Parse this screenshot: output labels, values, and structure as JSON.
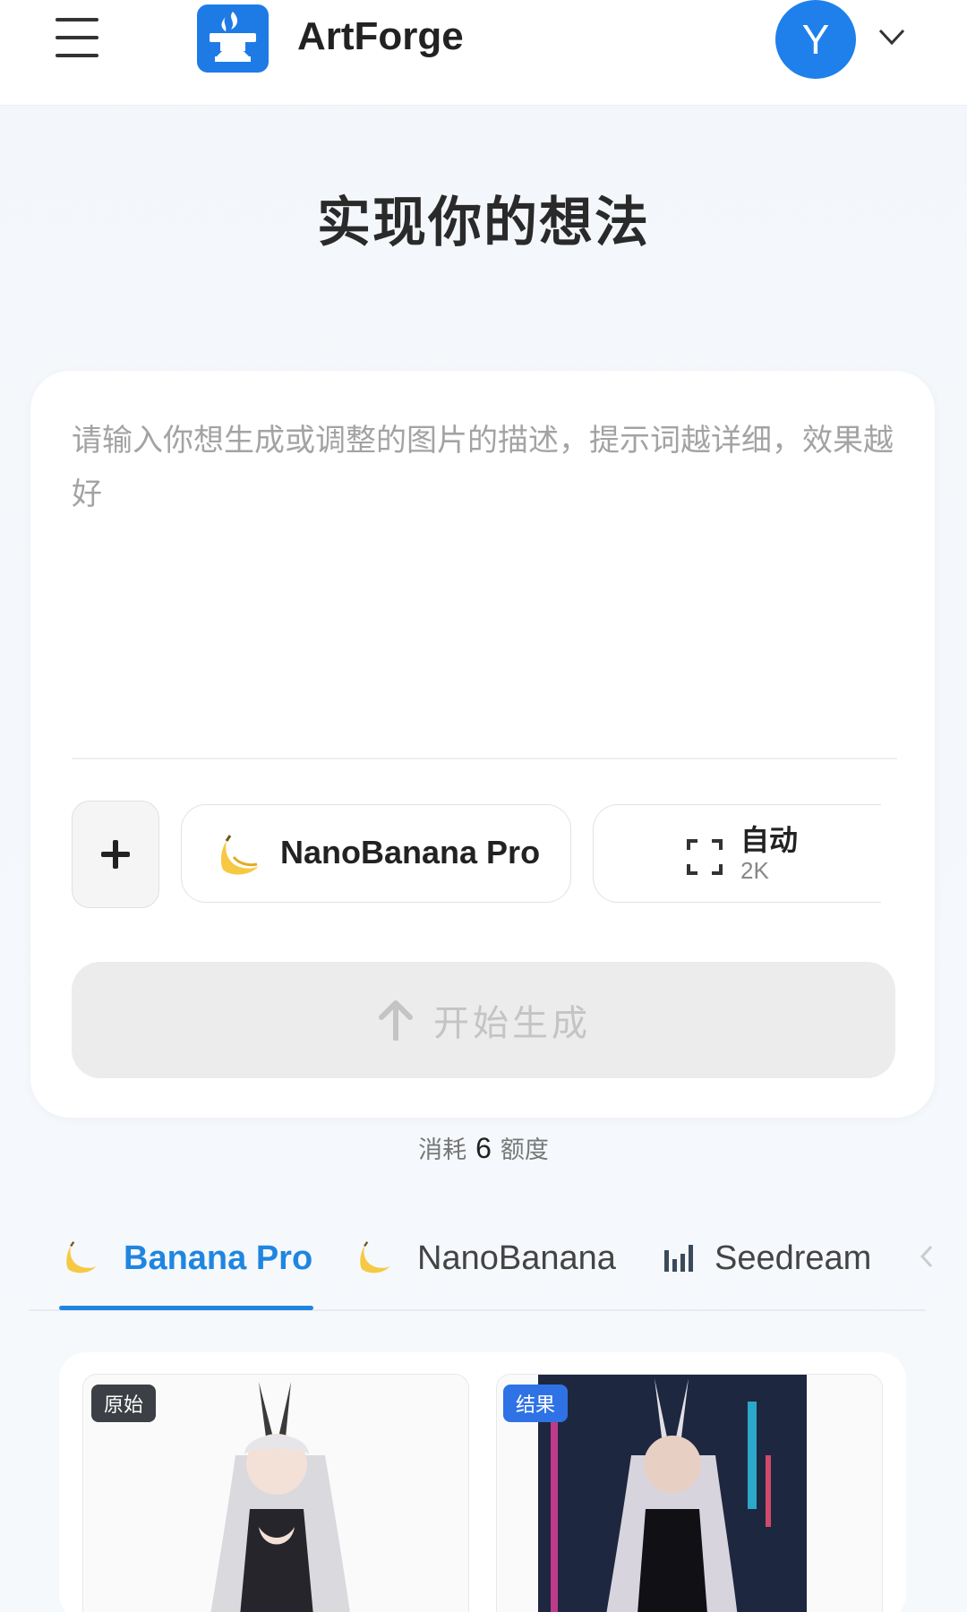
{
  "header": {
    "brand": "ArtForge",
    "avatar_letter": "Y"
  },
  "page_title": "实现你的想法",
  "prompt": {
    "placeholder": "请输入你想生成或调整的图片的描述，提示词越详细，效果越好",
    "value": ""
  },
  "toolbar": {
    "add_label": "+",
    "model_label": "NanoBanana Pro",
    "size_main": "自动",
    "size_sub": "2K"
  },
  "generate_label": "开始生成",
  "cost": {
    "prefix": "消耗",
    "amount": "6",
    "suffix": "额度"
  },
  "tabs": [
    {
      "label": "Banana Pro",
      "icon": "banana-icon",
      "active": true
    },
    {
      "label": "NanoBanana",
      "icon": "banana-icon",
      "active": false
    },
    {
      "label": "Seedream",
      "icon": "bar-chart-icon",
      "active": false
    }
  ],
  "gallery": {
    "original_tag": "原始",
    "result_tag": "结果"
  },
  "colors": {
    "accent": "#1f86e0",
    "logo": "#1e7be6",
    "avatar": "#1f80ec"
  }
}
